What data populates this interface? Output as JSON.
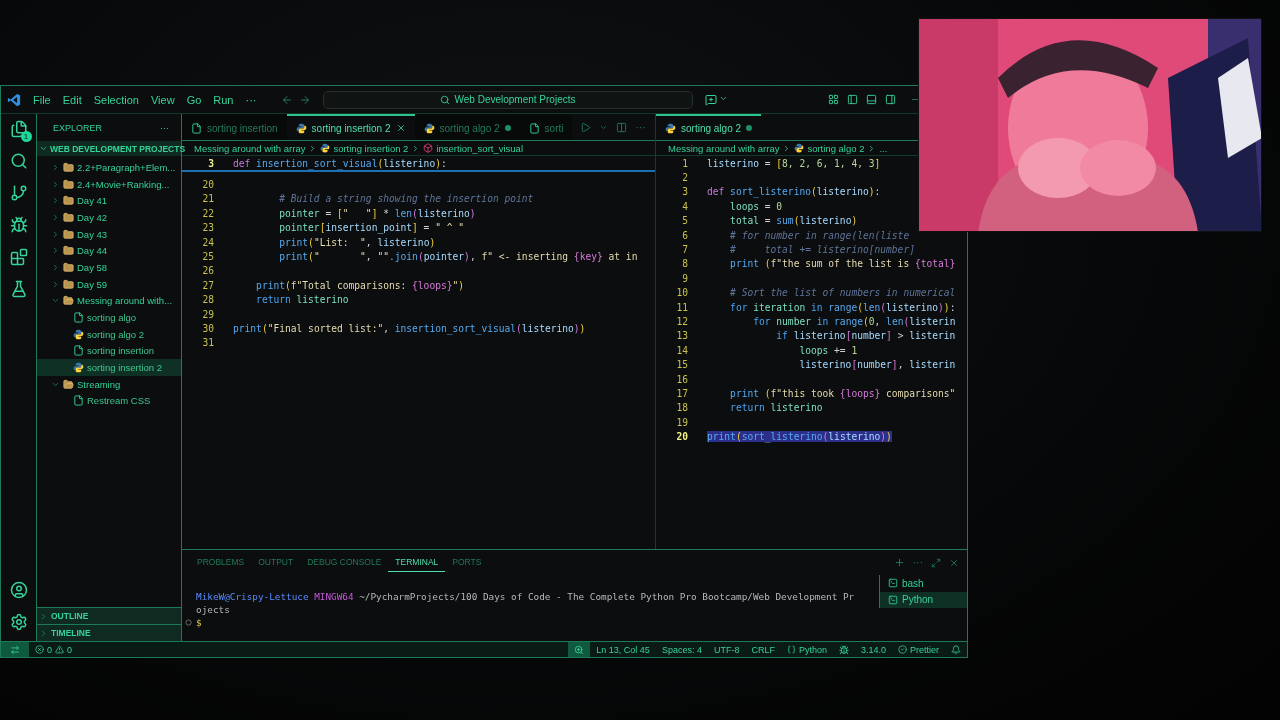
{
  "title_bar": {
    "menus": [
      "File",
      "Edit",
      "Selection",
      "View",
      "Go",
      "Run",
      "···"
    ],
    "search": "Web Development Projects"
  },
  "activity_bar": {
    "explorer_badge": "1"
  },
  "sidebar": {
    "title": "EXPLORER",
    "more": "···",
    "section": {
      "title": "WEB DEVELOPMENT PROJECTS",
      "expanded": true
    },
    "tree": [
      {
        "label": "2.2+Paragraph+Elem...",
        "kind": "folder",
        "expanded": false,
        "selected": false
      },
      {
        "label": "2.4+Movie+Ranking...",
        "kind": "folder",
        "expanded": false,
        "selected": false
      },
      {
        "label": "Day 41",
        "kind": "folder",
        "expanded": false,
        "selected": false
      },
      {
        "label": "Day 42",
        "kind": "folder",
        "expanded": false,
        "selected": false
      },
      {
        "label": "Day 43",
        "kind": "folder",
        "expanded": false,
        "selected": false
      },
      {
        "label": "Day 44",
        "kind": "folder",
        "expanded": false,
        "selected": false
      },
      {
        "label": "Day 58",
        "kind": "folder",
        "expanded": false,
        "selected": false
      },
      {
        "label": "Day 59",
        "kind": "folder",
        "expanded": false,
        "selected": false
      },
      {
        "label": "Messing around with...",
        "kind": "folder",
        "expanded": true,
        "selected": false,
        "children": [
          {
            "label": "sorting algo",
            "kind": "file",
            "selected": false
          },
          {
            "label": "sorting algo 2",
            "kind": "python",
            "selected": false
          },
          {
            "label": "sorting insertion",
            "kind": "file",
            "selected": false
          },
          {
            "label": "sorting insertion 2",
            "kind": "python",
            "selected": true
          }
        ]
      },
      {
        "label": "Streaming",
        "kind": "folder",
        "expanded": true,
        "selected": false,
        "children": [
          {
            "label": "Restream CSS",
            "kind": "file",
            "selected": false
          }
        ]
      }
    ],
    "bottom_sections": [
      {
        "title": "OUTLINE",
        "expanded": false
      },
      {
        "title": "TIMELINE",
        "expanded": false
      }
    ]
  },
  "editors": [
    {
      "tabs": [
        {
          "label": "sorting insertion",
          "kind": "file",
          "selected": false,
          "modified": false
        },
        {
          "label": "sorting insertion 2",
          "kind": "python",
          "selected": true,
          "modified": false
        },
        {
          "label": "sorting algo 2",
          "kind": "python",
          "selected": false,
          "modified": true
        },
        {
          "label": "sorti",
          "kind": "file",
          "selected": false,
          "modified": false
        }
      ],
      "actions": {
        "more": "···"
      },
      "breadcrumbs": [
        {
          "text": "Messing around with array",
          "kind": "folder"
        },
        {
          "text": "sorting insertion 2",
          "kind": "python"
        },
        {
          "text": "insertion_sort_visual",
          "kind": "symbol"
        }
      ],
      "sticky": {
        "number": "3",
        "tokens": [
          {
            "kind": "keyword",
            "text": "def "
          },
          {
            "kind": "function",
            "text": "insertion_sort_visual"
          },
          {
            "kind": "paren",
            "text": "("
          },
          {
            "kind": "param",
            "text": "listerino"
          },
          {
            "kind": "paren",
            "text": ")"
          },
          {
            "kind": "op",
            "text": ":"
          }
        ]
      },
      "lines": [
        {
          "number": "20",
          "selected": false
        },
        {
          "number": "21",
          "selected": false,
          "tokens": [
            {
              "kind": "comment",
              "text": "        # Build a string showing the insertion point"
            }
          ]
        },
        {
          "number": "22",
          "selected": false,
          "tokens": [
            {
              "kind": "variable",
              "text": "        pointer"
            },
            {
              "kind": "op",
              "text": " = "
            },
            {
              "kind": "paren",
              "text": "["
            },
            {
              "kind": "string",
              "text": "\"   \""
            },
            {
              "kind": "paren",
              "text": "]"
            },
            {
              "kind": "op",
              "text": " * "
            },
            {
              "kind": "function",
              "text": "len"
            },
            {
              "kind": "bracket",
              "text": "("
            },
            {
              "kind": "param",
              "text": "listerino"
            },
            {
              "kind": "bracket",
              "text": ")"
            }
          ]
        },
        {
          "number": "23",
          "selected": false,
          "tokens": [
            {
              "kind": "variable",
              "text": "        pointer"
            },
            {
              "kind": "paren",
              "text": "["
            },
            {
              "kind": "param",
              "text": "insertion_point"
            },
            {
              "kind": "paren",
              "text": "]"
            },
            {
              "kind": "op",
              "text": " = "
            },
            {
              "kind": "string",
              "text": "\" ^ \""
            }
          ]
        },
        {
          "number": "24",
          "selected": false,
          "tokens": [
            {
              "kind": "function",
              "text": "        print"
            },
            {
              "kind": "paren",
              "text": "("
            },
            {
              "kind": "string",
              "text": "\"List:  \""
            },
            {
              "kind": "op",
              "text": ", "
            },
            {
              "kind": "param",
              "text": "listerino"
            },
            {
              "kind": "paren",
              "text": ")"
            }
          ]
        },
        {
          "number": "25",
          "selected": false,
          "tokens": [
            {
              "kind": "function",
              "text": "        print"
            },
            {
              "kind": "paren",
              "text": "("
            },
            {
              "kind": "string",
              "text": "\"       \""
            },
            {
              "kind": "op",
              "text": ", "
            },
            {
              "kind": "string",
              "text": "\"\""
            },
            {
              "kind": "function",
              "text": ".join"
            },
            {
              "kind": "bracket",
              "text": "("
            },
            {
              "kind": "param",
              "text": "pointer"
            },
            {
              "kind": "bracket",
              "text": ")"
            },
            {
              "kind": "op",
              "text": ", "
            },
            {
              "kind": "string",
              "text": "f\" <- inserting "
            },
            {
              "kind": "bracket",
              "text": "{key}"
            },
            {
              "kind": "string",
              "text": " at in"
            }
          ]
        },
        {
          "number": "26",
          "selected": false
        },
        {
          "number": "27",
          "selected": false,
          "tokens": [
            {
              "kind": "function",
              "text": "    print"
            },
            {
              "kind": "paren",
              "text": "("
            },
            {
              "kind": "string",
              "text": "f\"Total comparisons: "
            },
            {
              "kind": "bracket",
              "text": "{loops}"
            },
            {
              "kind": "string",
              "text": "\""
            },
            {
              "kind": "paren",
              "text": ")"
            }
          ]
        },
        {
          "number": "28",
          "selected": false,
          "tokens": [
            {
              "kind": "control",
              "text": "    return"
            },
            {
              "kind": "variable",
              "text": " listerino"
            }
          ]
        },
        {
          "number": "29",
          "selected": false
        },
        {
          "number": "30",
          "selected": false,
          "tokens": [
            {
              "kind": "function",
              "text": "print"
            },
            {
              "kind": "paren",
              "text": "("
            },
            {
              "kind": "string",
              "text": "\"Final sorted list:\""
            },
            {
              "kind": "op",
              "text": ", "
            },
            {
              "kind": "function",
              "text": "insertion_sort_visual"
            },
            {
              "kind": "bracket",
              "text": "("
            },
            {
              "kind": "param",
              "text": "listerino"
            },
            {
              "kind": "bracket",
              "text": ")"
            },
            {
              "kind": "paren",
              "text": ")"
            }
          ]
        },
        {
          "number": "31",
          "selected": false
        }
      ]
    },
    {
      "tabs": [
        {
          "label": "sorting algo 2",
          "kind": "python",
          "selected": true,
          "modified": true
        }
      ],
      "breadcrumbs": [
        {
          "text": "Messing around with array",
          "kind": "folder"
        },
        {
          "text": "sorting algo 2",
          "kind": "python"
        },
        {
          "text": "...",
          "kind": "more"
        }
      ],
      "lines": [
        {
          "number": "1",
          "selected": false,
          "tokens": [
            {
              "kind": "param",
              "text": "listerino"
            },
            {
              "kind": "op",
              "text": " = "
            },
            {
              "kind": "paren",
              "text": "["
            },
            {
              "kind": "number",
              "text": "8, 2, 6, 1, 4, 3"
            },
            {
              "kind": "paren",
              "text": "]"
            }
          ]
        },
        {
          "number": "2",
          "selected": false
        },
        {
          "number": "3",
          "selected": false,
          "tokens": [
            {
              "kind": "keyword",
              "text": "def "
            },
            {
              "kind": "function",
              "text": "sort_listerino"
            },
            {
              "kind": "paren",
              "text": "("
            },
            {
              "kind": "param",
              "text": "listerino"
            },
            {
              "kind": "paren",
              "text": ")"
            },
            {
              "kind": "op",
              "text": ":"
            }
          ]
        },
        {
          "number": "4",
          "selected": false,
          "tokens": [
            {
              "kind": "variable",
              "text": "    loops"
            },
            {
              "kind": "op",
              "text": " = "
            },
            {
              "kind": "number",
              "text": "0"
            }
          ]
        },
        {
          "number": "5",
          "selected": false,
          "tokens": [
            {
              "kind": "variable",
              "text": "    total"
            },
            {
              "kind": "op",
              "text": " = "
            },
            {
              "kind": "function",
              "text": "sum"
            },
            {
              "kind": "paren",
              "text": "("
            },
            {
              "kind": "param",
              "text": "listerino"
            },
            {
              "kind": "paren",
              "text": ")"
            }
          ]
        },
        {
          "number": "6",
          "selected": false,
          "tokens": [
            {
              "kind": "comment",
              "text": "    # for number in range(len(liste"
            }
          ]
        },
        {
          "number": "7",
          "selected": false,
          "tokens": [
            {
              "kind": "comment",
              "text": "    #     total += listerino[number]"
            }
          ]
        },
        {
          "number": "8",
          "selected": false,
          "tokens": [
            {
              "kind": "function",
              "text": "    print "
            },
            {
              "kind": "paren",
              "text": "("
            },
            {
              "kind": "string",
              "text": "f\"the sum of the list is "
            },
            {
              "kind": "bracket",
              "text": "{total}"
            }
          ]
        },
        {
          "number": "9",
          "selected": false
        },
        {
          "number": "10",
          "selected": false,
          "tokens": [
            {
              "kind": "comment",
              "text": "    # Sort the list of numbers in numerical"
            }
          ]
        },
        {
          "number": "11",
          "selected": false,
          "tokens": [
            {
              "kind": "control",
              "text": "    for"
            },
            {
              "kind": "variable",
              "text": " iteration"
            },
            {
              "kind": "control",
              "text": " in "
            },
            {
              "kind": "function",
              "text": "range"
            },
            {
              "kind": "paren",
              "text": "("
            },
            {
              "kind": "function",
              "text": "len"
            },
            {
              "kind": "bracket",
              "text": "("
            },
            {
              "kind": "param",
              "text": "listerino"
            },
            {
              "kind": "bracket",
              "text": ")"
            },
            {
              "kind": "paren",
              "text": ")"
            },
            {
              "kind": "op",
              "text": ":"
            }
          ]
        },
        {
          "number": "12",
          "selected": false,
          "tokens": [
            {
              "kind": "control",
              "text": "        for"
            },
            {
              "kind": "variable",
              "text": " number"
            },
            {
              "kind": "control",
              "text": " in "
            },
            {
              "kind": "function",
              "text": "range"
            },
            {
              "kind": "paren",
              "text": "("
            },
            {
              "kind": "number",
              "text": "0"
            },
            {
              "kind": "op",
              "text": ", "
            },
            {
              "kind": "function",
              "text": "len"
            },
            {
              "kind": "bracket",
              "text": "("
            },
            {
              "kind": "param",
              "text": "listerin"
            }
          ]
        },
        {
          "number": "13",
          "selected": false,
          "tokens": [
            {
              "kind": "control",
              "text": "            if"
            },
            {
              "kind": "param",
              "text": " listerino"
            },
            {
              "kind": "bracket",
              "text": "["
            },
            {
              "kind": "param",
              "text": "number"
            },
            {
              "kind": "bracket",
              "text": "]"
            },
            {
              "kind": "op",
              "text": " > "
            },
            {
              "kind": "param",
              "text": "listerin"
            }
          ]
        },
        {
          "number": "14",
          "selected": false,
          "tokens": [
            {
              "kind": "variable",
              "text": "                loops"
            },
            {
              "kind": "op",
              "text": " += "
            },
            {
              "kind": "number",
              "text": "1"
            }
          ]
        },
        {
          "number": "15",
          "selected": false,
          "tokens": [
            {
              "kind": "param",
              "text": "                listerino"
            },
            {
              "kind": "bracket",
              "text": "["
            },
            {
              "kind": "param",
              "text": "number"
            },
            {
              "kind": "bracket",
              "text": "]"
            },
            {
              "kind": "op",
              "text": ", "
            },
            {
              "kind": "param",
              "text": "listerin"
            }
          ]
        },
        {
          "number": "16",
          "selected": false
        },
        {
          "number": "17",
          "selected": false,
          "tokens": [
            {
              "kind": "function",
              "text": "    print "
            },
            {
              "kind": "paren",
              "text": "("
            },
            {
              "kind": "string",
              "text": "f\"this took "
            },
            {
              "kind": "bracket",
              "text": "{loops}"
            },
            {
              "kind": "string",
              "text": " comparisons\""
            }
          ]
        },
        {
          "number": "18",
          "selected": false,
          "tokens": [
            {
              "kind": "control",
              "text": "    return"
            },
            {
              "kind": "variable",
              "text": " listerino"
            }
          ]
        },
        {
          "number": "19",
          "selected": false
        },
        {
          "number": "20",
          "selected": true,
          "tokens": [
            {
              "kind": "function",
              "text": "print"
            },
            {
              "kind": "paren",
              "text": "("
            },
            {
              "kind": "function",
              "text": "sort_listerino"
            },
            {
              "kind": "bracket",
              "text": "("
            },
            {
              "kind": "param",
              "text": "listerino"
            },
            {
              "kind": "bracket",
              "text": ")"
            },
            {
              "kind": "paren",
              "text": ")"
            }
          ]
        }
      ]
    }
  ],
  "panel": {
    "more": "···",
    "tabs": [
      {
        "label": "PROBLEMS",
        "selected": false
      },
      {
        "label": "OUTPUT",
        "selected": false
      },
      {
        "label": "DEBUG CONSOLE",
        "selected": false
      },
      {
        "label": "TERMINAL",
        "selected": true
      },
      {
        "label": "PORTS",
        "selected": false
      }
    ],
    "terminal": {
      "user": "MikeW@Crispy-Lettuce",
      "system": "MINGW64",
      "path": "~/PycharmProjects/100 Days of Code - The Complete Python Pro Bootcamp/Web Development Pr",
      "path_wrap": "ojects",
      "prompt": "$"
    },
    "sessions": [
      {
        "label": "bash",
        "selected": false
      },
      {
        "label": "Python",
        "selected": true
      }
    ]
  },
  "status_bar": {
    "errors": "0",
    "warnings": "0",
    "items": [
      {
        "kind": "zoom"
      },
      {
        "kind": "text",
        "text": "Ln 13, Col 45"
      },
      {
        "kind": "text",
        "text": "Spaces: 4"
      },
      {
        "kind": "text",
        "text": "UTF-8"
      },
      {
        "kind": "text",
        "text": "CRLF"
      },
      {
        "kind": "language",
        "text": "Python"
      },
      {
        "kind": "version",
        "text": "3.14.0"
      },
      {
        "kind": "formatter",
        "text": "Prettier"
      },
      {
        "kind": "bell"
      }
    ]
  }
}
